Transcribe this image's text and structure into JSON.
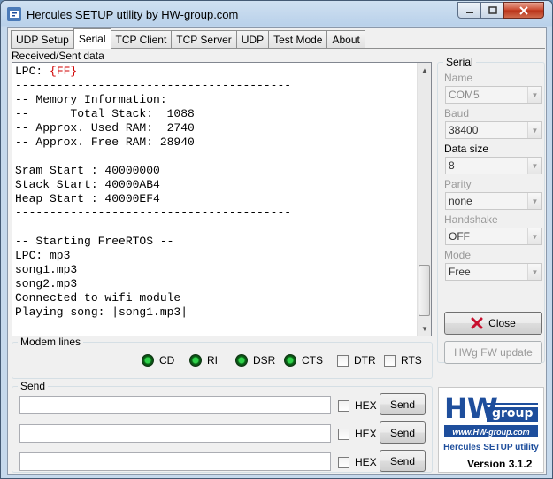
{
  "window": {
    "title": "Hercules SETUP utility by HW-group.com"
  },
  "tabs": [
    "UDP Setup",
    "Serial",
    "TCP Client",
    "TCP Server",
    "UDP",
    "Test Mode",
    "About"
  ],
  "received": {
    "label": "Received/Sent data",
    "line0_prefix": "LPC: ",
    "line0_red": "{FF}",
    "lines": [
      "----------------------------------------",
      "-- Memory Information:",
      "--      Total Stack:  1088",
      "-- Approx. Used RAM:  2740",
      "-- Approx. Free RAM: 28940",
      "",
      "Sram Start : 40000000",
      "Stack Start: 40000AB4",
      "Heap Start : 40000EF4",
      "----------------------------------------",
      "",
      "-- Starting FreeRTOS --",
      "LPC: mp3",
      "song1.mp3",
      "song2.mp3",
      "Connected to wifi module",
      "Playing song: |song1.mp3|"
    ]
  },
  "modem": {
    "title": "Modem lines",
    "leds": [
      "CD",
      "RI",
      "DSR",
      "CTS"
    ],
    "checks": [
      "DTR",
      "RTS"
    ]
  },
  "serial": {
    "title": "Serial",
    "name_label": "Name",
    "name_value": "COM5",
    "baud_label": "Baud",
    "baud_value": "38400",
    "datasize_label": "Data size",
    "datasize_value": "8",
    "parity_label": "Parity",
    "parity_value": "none",
    "handshake_label": "Handshake",
    "handshake_value": "OFF",
    "mode_label": "Mode",
    "mode_value": "Free",
    "close_label": "Close",
    "fw_label": "HWg FW update"
  },
  "send": {
    "title": "Send",
    "hex_label": "HEX",
    "send_label": "Send"
  },
  "logo": {
    "hw": "HW",
    "group": "group",
    "url": "www.HW-group.com",
    "product": "Hercules SETUP utility",
    "version_label": "Version",
    "version": "3.1.2"
  },
  "colors": {
    "accent_blue": "#1e4e9c",
    "close_red": "#c8102e"
  }
}
